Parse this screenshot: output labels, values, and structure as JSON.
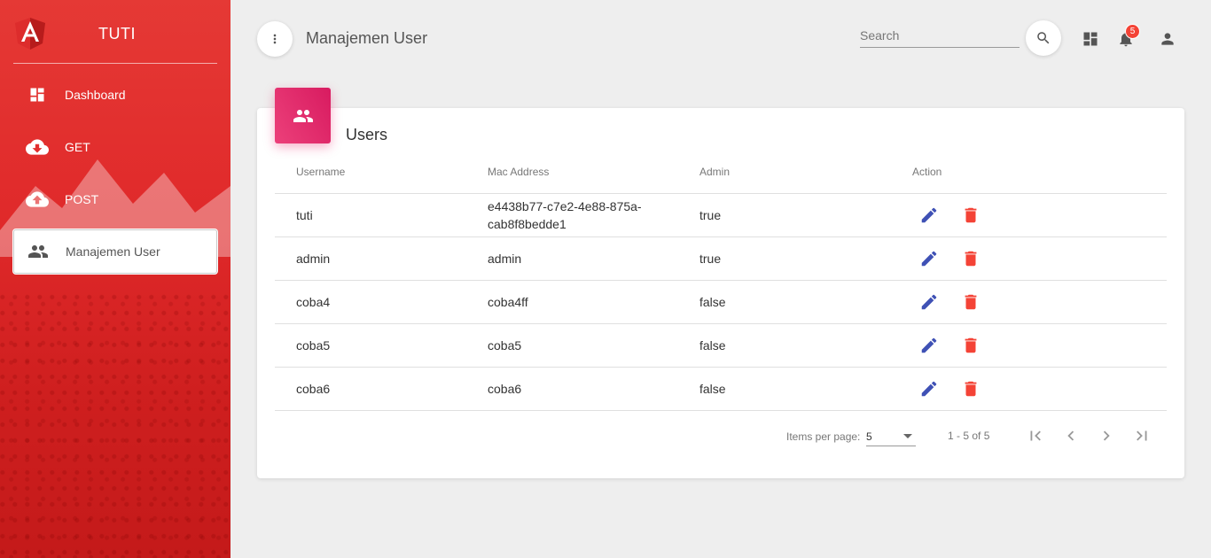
{
  "sidebar": {
    "brand": "TUTI",
    "items": [
      {
        "label": "Dashboard",
        "icon": "dashboard-icon"
      },
      {
        "label": "GET",
        "icon": "cloud-download-icon"
      },
      {
        "label": "POST",
        "icon": "cloud-upload-icon"
      },
      {
        "label": "Manajemen User",
        "icon": "people-icon",
        "active": true
      }
    ]
  },
  "header": {
    "title": "Manajemen User",
    "search_placeholder": "Search",
    "notification_count": "5"
  },
  "card": {
    "title": "Users",
    "columns": [
      "Username",
      "Mac Address",
      "Admin",
      "Action"
    ],
    "rows": [
      {
        "username": "tuti",
        "mac": "e4438b77-c7e2-4e88-875a-cab8f8bedde1",
        "admin": "true"
      },
      {
        "username": "admin",
        "mac": "admin",
        "admin": "true"
      },
      {
        "username": "coba4",
        "mac": "coba4ff",
        "admin": "false"
      },
      {
        "username": "coba5",
        "mac": "coba5",
        "admin": "false"
      },
      {
        "username": "coba6",
        "mac": "coba6",
        "admin": "false"
      }
    ]
  },
  "paginator": {
    "items_per_page_label": "Items per page:",
    "items_per_page": "5",
    "range": "1 - 5 of 5"
  },
  "colors": {
    "sidebar": "#e53935",
    "edit_icon": "#3f51b5",
    "delete_icon": "#f44336",
    "card_header": "#e91e63"
  }
}
